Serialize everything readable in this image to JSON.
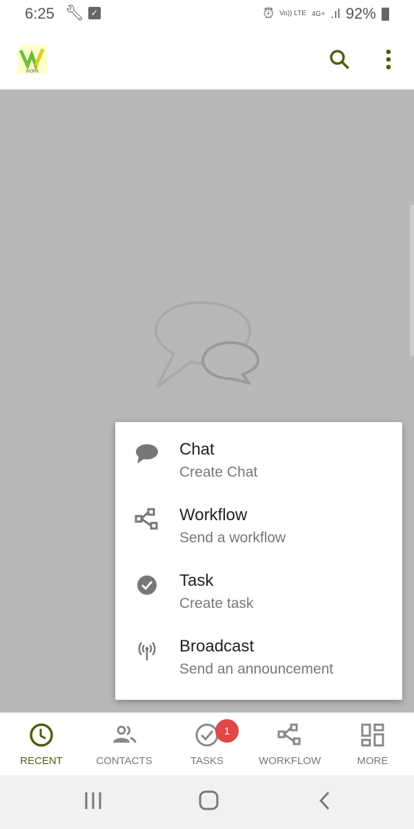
{
  "status": {
    "time": "6:25",
    "network": "Vo)) LTE",
    "data": "4G+",
    "battery": "92%"
  },
  "appbar": {
    "logo_text": "WORK"
  },
  "menu": {
    "items": [
      {
        "title": "Chat",
        "subtitle": "Create Chat",
        "icon": "chat-bubble-icon"
      },
      {
        "title": "Workflow",
        "subtitle": "Send a workflow",
        "icon": "workflow-icon"
      },
      {
        "title": "Task",
        "subtitle": "Create task",
        "icon": "check-circle-icon"
      },
      {
        "title": "Broadcast",
        "subtitle": "Send an announcement",
        "icon": "broadcast-icon"
      }
    ]
  },
  "nav": {
    "tabs": [
      {
        "label": "RECENT",
        "active": true
      },
      {
        "label": "CONTACTS"
      },
      {
        "label": "TASKS",
        "badge": "1"
      },
      {
        "label": "WORKFLOW"
      },
      {
        "label": "MORE"
      }
    ]
  },
  "colors": {
    "accent": "#555a10",
    "badge": "#e04848",
    "overlay": "#b8b8b8"
  }
}
